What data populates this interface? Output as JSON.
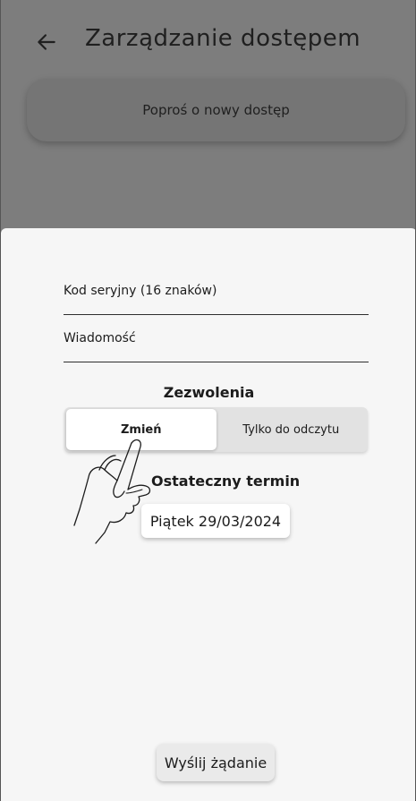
{
  "app_bar": {
    "title": "Zarządzanie dostępem",
    "back_icon": "arrow-left-icon"
  },
  "request_card": {
    "label": "Poproś o nowy dostęp"
  },
  "sheet": {
    "serial_field": {
      "label": "Kod seryjny (16 znaków)",
      "value": ""
    },
    "message_field": {
      "label": "Wiadomość",
      "value": ""
    },
    "permissions": {
      "title": "Zezwolenia",
      "options": [
        "Zmień",
        "Tylko do odczytu"
      ],
      "selected": "Zmień"
    },
    "deadline": {
      "title": "Ostateczny termin",
      "value": "Piątek 29/03/2024"
    },
    "send_button": "Wyślij żądanie"
  },
  "overlay": {
    "icon": "pointing-hand-icon"
  },
  "colors": {
    "scrim": "#7d7d7d",
    "sheet": "#f6f6f6"
  }
}
